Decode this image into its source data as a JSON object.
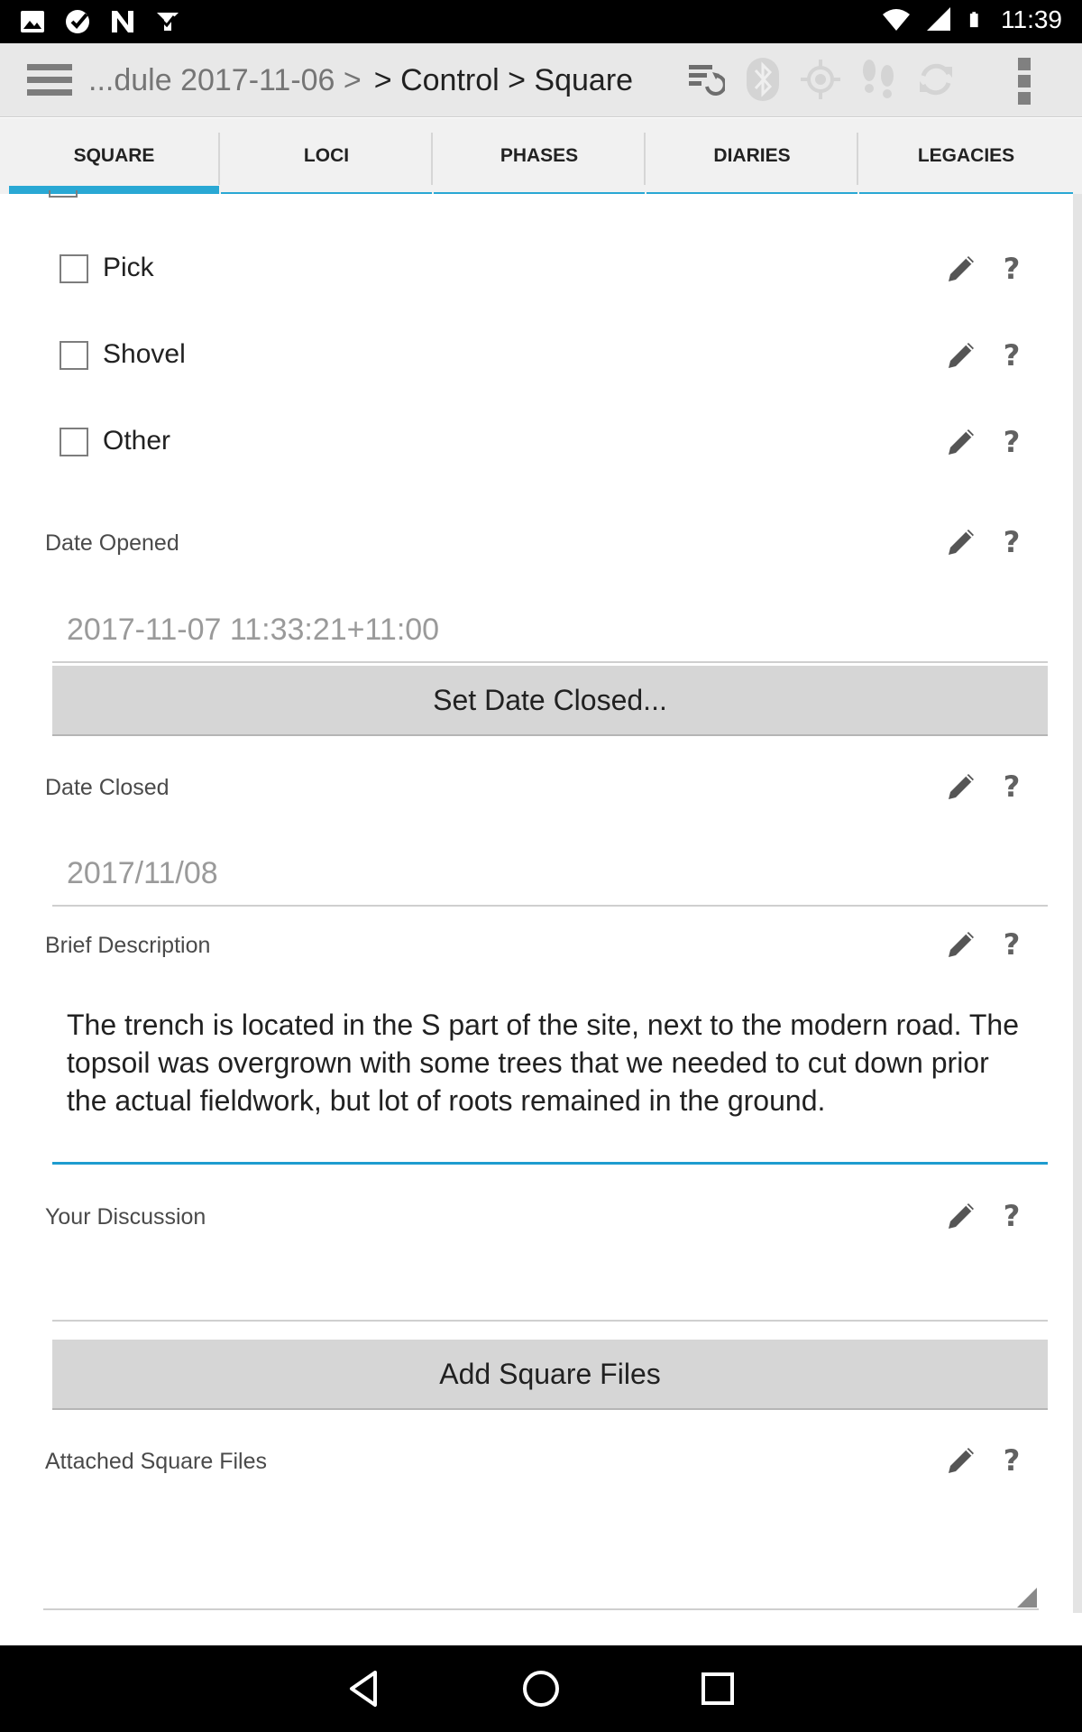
{
  "status_bar": {
    "time": "11:39",
    "left_icons": [
      "image-icon",
      "clock-check-icon",
      "n-icon",
      "download-check-icon"
    ],
    "right_icons": [
      "wifi-icon",
      "cell-signal-icon",
      "battery-icon"
    ]
  },
  "action_bar": {
    "breadcrumb_prev": "...dule 2017-11-06 >",
    "breadcrumb_current": "> Control > Square",
    "icons": [
      "sync-icon",
      "bluetooth-icon",
      "gps-icon",
      "footsteps-icon",
      "refresh-icon"
    ]
  },
  "tabs": [
    {
      "label": "SQUARE",
      "active": true
    },
    {
      "label": "LOCI",
      "active": false
    },
    {
      "label": "PHASES",
      "active": false
    },
    {
      "label": "DIARIES",
      "active": false
    },
    {
      "label": "LEGACIES",
      "active": false
    }
  ],
  "checkboxes": [
    {
      "label": "Pick",
      "checked": false
    },
    {
      "label": "Shovel",
      "checked": false
    },
    {
      "label": "Other",
      "checked": false
    }
  ],
  "date_opened": {
    "label": "Date Opened",
    "value": "2017-11-07 11:33:21+11:00"
  },
  "set_date_closed_button": "Set Date Closed...",
  "date_closed": {
    "label": "Date Closed",
    "value": "2017/11/08"
  },
  "brief_description": {
    "label": "Brief Description",
    "value": "The trench is located in the S part of the site, next to the modern road. The topsoil was overgrown with some trees that we needed to cut down prior the actual fieldwork, but lot of roots remained in the ground."
  },
  "your_discussion": {
    "label": "Your Discussion",
    "value": ""
  },
  "add_files_button": "Add Square Files",
  "attached_files": {
    "label": "Attached Square Files"
  },
  "help_glyph": "?",
  "colors": {
    "accent": "#1e9ccf",
    "tab_line": "#29a8d4",
    "button_bg": "#d6d6d6",
    "action_bar_bg": "#e8e8e8"
  }
}
